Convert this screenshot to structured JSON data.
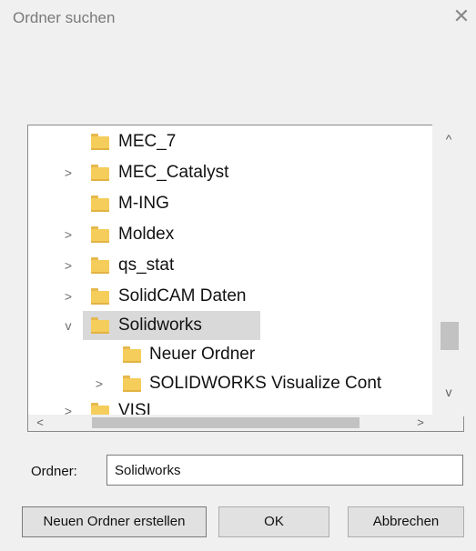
{
  "dialog": {
    "title": "Ordner suchen",
    "close_glyph": "✕"
  },
  "tree": {
    "items": [
      {
        "label": "MEC_7",
        "chevron": "",
        "selected": false
      },
      {
        "label": "MEC_Catalyst",
        "chevron": ">",
        "selected": false
      },
      {
        "label": "M-ING",
        "chevron": "",
        "selected": false
      },
      {
        "label": "Moldex",
        "chevron": ">",
        "selected": false
      },
      {
        "label": "qs_stat",
        "chevron": ">",
        "selected": false
      },
      {
        "label": "SolidCAM Daten",
        "chevron": ">",
        "selected": false
      },
      {
        "label": "Solidworks",
        "chevron": "v",
        "selected": true
      },
      {
        "label": "Neuer Ordner",
        "chevron": "",
        "selected": false
      },
      {
        "label": "SOLIDWORKS Visualize Cont",
        "chevron": ">",
        "selected": false
      },
      {
        "label": "VISI",
        "chevron": ">",
        "selected": false
      }
    ]
  },
  "scroll": {
    "up": "^",
    "down": "v",
    "left": "<",
    "right": ">"
  },
  "folder_field": {
    "label": "Ordner:",
    "value": "Solidworks"
  },
  "buttons": {
    "new_folder": "Neuen Ordner erstellen",
    "ok": "OK",
    "cancel": "Abbrechen"
  },
  "colors": {
    "folder": "#f5cd5b",
    "selection": "#d9d9d9"
  }
}
